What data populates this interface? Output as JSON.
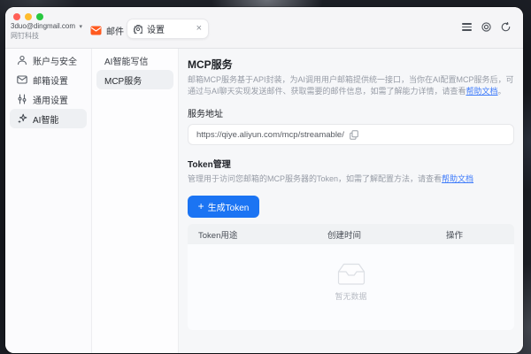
{
  "titlebar": {
    "email": "3duo@dingmail.com",
    "company": "网钉科技",
    "mail_tab_label": "邮件",
    "settings_tab_label": "设置"
  },
  "sidebar": {
    "items": [
      "账户与安全",
      "邮箱设置",
      "通用设置",
      "AI智能"
    ],
    "selected": "AI智能"
  },
  "subnav": {
    "items": [
      "AI智能写信",
      "MCP服务"
    ],
    "selected": "MCP服务"
  },
  "main": {
    "title": "MCP服务",
    "desc_before": "邮箱MCP服务基于API封装，为AI调用用户邮箱提供统一接口，当你在AI配置MCP服务后，可通过与AI聊天实现发送邮件、获取需要的邮件信息，如需了解能力详情，请查看",
    "desc_link": "帮助文档",
    "desc_after": "。",
    "service": {
      "label": "服务地址",
      "value": "https://qiye.aliyun.com/mcp/streamable/"
    },
    "token": {
      "title": "Token管理",
      "desc_before": "管理用于访问您邮箱的MCP服务器的Token，如需了解配置方法，请查看",
      "desc_link": "帮助文档",
      "generate_label": "生成Token"
    },
    "table": {
      "columns": [
        "Token用途",
        "创建时间",
        "操作"
      ],
      "rows": [],
      "empty_text": "暂无数据"
    }
  },
  "icons": {
    "caret_down": "▾",
    "close": "×",
    "plus": "+",
    "menu": "hamburger-lines",
    "theme": "double-circle",
    "sync": "circular-arrow",
    "copy": "two-squares",
    "empty": "open-box"
  },
  "colors": {
    "accent_blue": "#1b74f3",
    "link_blue": "#3e7bfa",
    "mail_orange": "#ff5a1f",
    "toolbar_bg": "#f5f5f7",
    "main_bg": "#f6f7f9"
  }
}
